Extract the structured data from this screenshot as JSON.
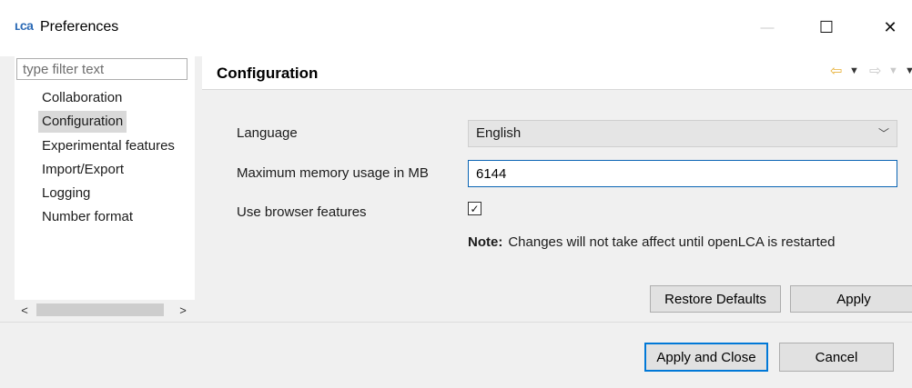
{
  "window": {
    "icon_text": "LCA",
    "title": "Preferences",
    "controls": {
      "minimize": "—",
      "maximize": "☐",
      "close": "✕"
    }
  },
  "sidebar": {
    "filter_placeholder": "type filter text",
    "items": [
      {
        "label": "Collaboration",
        "selected": false
      },
      {
        "label": "Configuration",
        "selected": true
      },
      {
        "label": "Experimental features",
        "selected": false
      },
      {
        "label": "Import/Export",
        "selected": false
      },
      {
        "label": "Logging",
        "selected": false
      },
      {
        "label": "Number format",
        "selected": false
      }
    ],
    "scroll_left": "<",
    "scroll_right": ">"
  },
  "page": {
    "title": "Configuration",
    "nav": {
      "back_icon": "arrow-left-icon",
      "forward_icon": "arrow-right-icon"
    },
    "fields": {
      "language_label": "Language",
      "language_value": "English",
      "memory_label": "Maximum memory usage in MB",
      "memory_value": "6144",
      "browser_label": "Use browser features",
      "browser_checked": true
    },
    "note_label": "Note:",
    "note_text": "Changes will not take affect until openLCA is restarted",
    "restore_defaults": "Restore Defaults",
    "apply": "Apply"
  },
  "footer": {
    "apply_and_close": "Apply and Close",
    "cancel": "Cancel"
  },
  "colors": {
    "focus_border": "#0078d7",
    "selected_bg": "#d9d9d9",
    "nav_back": "#e8b23a"
  }
}
